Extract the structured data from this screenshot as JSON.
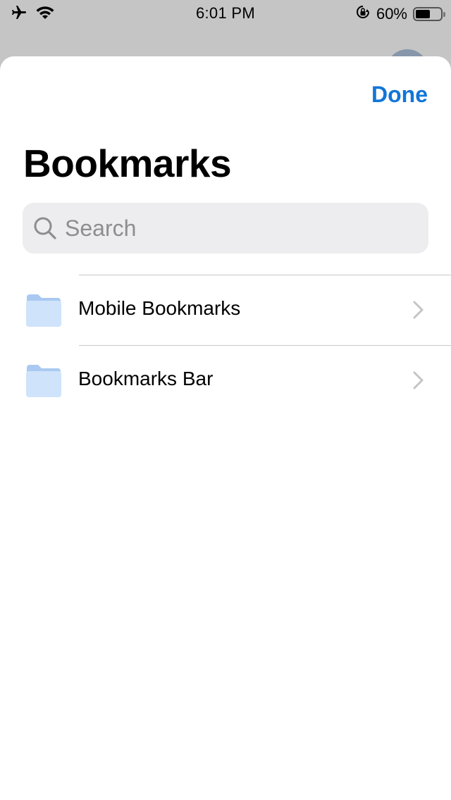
{
  "status_bar": {
    "time": "6:01 PM",
    "battery_percent": "60%",
    "battery_level": 0.6,
    "icons": [
      "airplane-icon",
      "wifi-icon",
      "orientation-lock-icon",
      "battery-icon"
    ]
  },
  "header": {
    "done_label": "Done",
    "title": "Bookmarks"
  },
  "search": {
    "placeholder": "Search"
  },
  "folders": [
    {
      "label": "Mobile Bookmarks",
      "icon": "folder-icon"
    },
    {
      "label": "Bookmarks Bar",
      "icon": "folder-icon"
    }
  ],
  "colors": {
    "accent": "#1275d8",
    "folder": "#cfe3fb",
    "folder_tab": "#a9c9f2",
    "search_bg": "#ededef"
  }
}
